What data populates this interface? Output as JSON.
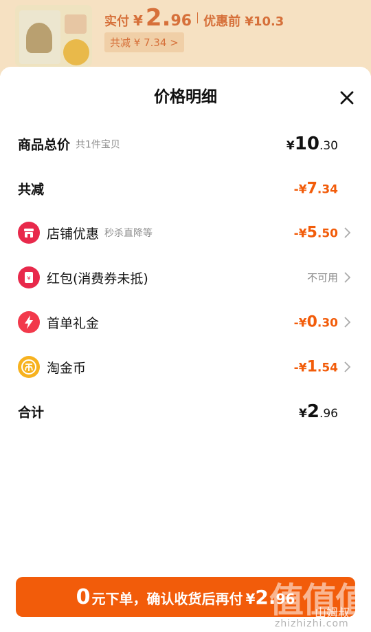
{
  "background": {
    "paid_label": "实付",
    "paid_currency": "¥",
    "paid_int": "2.",
    "paid_dec": "96",
    "before_label": "优惠前 ¥10.3",
    "saved_label": "共减 ¥ 7.34 >"
  },
  "sheet": {
    "title": "价格明细",
    "close_icon": "close-icon"
  },
  "rows": {
    "total": {
      "label": "商品总价",
      "sub": "共1件宝贝",
      "yen": "¥",
      "int": "10",
      "dec": ".30"
    },
    "reduction": {
      "label": "共减",
      "yen": "-¥",
      "int": "7",
      "dec": ".34"
    },
    "store_discount": {
      "icon": "store-icon",
      "label": "店铺优惠",
      "sub": "秒杀直降等",
      "yen": "-¥",
      "int": "5",
      "dec": ".50"
    },
    "red_packet": {
      "icon": "red-packet-icon",
      "label": "红包(消费券未抵)",
      "value": "不可用"
    },
    "first_order": {
      "icon": "lightning-icon",
      "label": "首单礼金",
      "yen": "-¥",
      "int": "0",
      "dec": ".30"
    },
    "tao_coin": {
      "icon": "coin-icon",
      "label": "淘金币",
      "yen": "-¥",
      "int": "1",
      "dec": ".54"
    },
    "sum": {
      "label": "合计",
      "yen": "¥",
      "int": "2",
      "dec": ".96"
    }
  },
  "cta": {
    "zero": "0",
    "text": "元下单，确认收货后再付",
    "yen": "¥",
    "int": "2.",
    "dec": "96"
  },
  "watermark": {
    "big": "值值值",
    "name": "山姆叔",
    "url": "zhizhizhi.com"
  },
  "colors": {
    "accent": "#f25c0a",
    "muted": "#8c8c8c",
    "store_icon": "#e8294b",
    "red_packet_icon": "#e8294b",
    "lightning_icon": "#f2394b",
    "coin_icon": "#f7b21f"
  }
}
